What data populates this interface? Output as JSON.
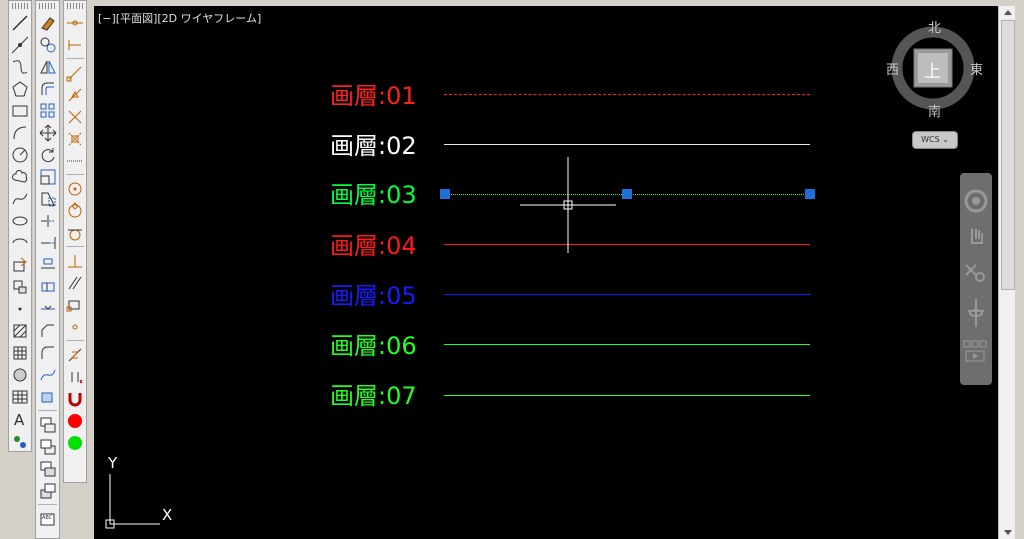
{
  "viewport": {
    "label": "[−][平面図][2D ワイヤフレーム]",
    "layers": [
      {
        "text": "画層:01",
        "color": "#ff2020",
        "line_style": "dashdot"
      },
      {
        "text": "画層:02",
        "color": "#ffffff",
        "line_style": "solid"
      },
      {
        "text": "画層:03",
        "color": "#00ff40",
        "line_style": "dotted",
        "selected": true
      },
      {
        "text": "画層:04",
        "color": "#ff1818",
        "line_style": "solid"
      },
      {
        "text": "画層:05",
        "color": "#1a1aff",
        "line_style": "solid"
      },
      {
        "text": "画層:06",
        "color": "#22ff22",
        "line_style": "solid"
      },
      {
        "text": "画層:07",
        "color": "#22ff22",
        "line_style": "solid"
      }
    ],
    "ucs": {
      "x_label": "X",
      "y_label": "Y"
    }
  },
  "viewcube": {
    "north": "北",
    "south": "南",
    "east": "東",
    "west": "西",
    "face": "上",
    "wcs_label": "WCS"
  },
  "colors": {
    "grip": "#1e6fd9",
    "background": "#000000"
  }
}
